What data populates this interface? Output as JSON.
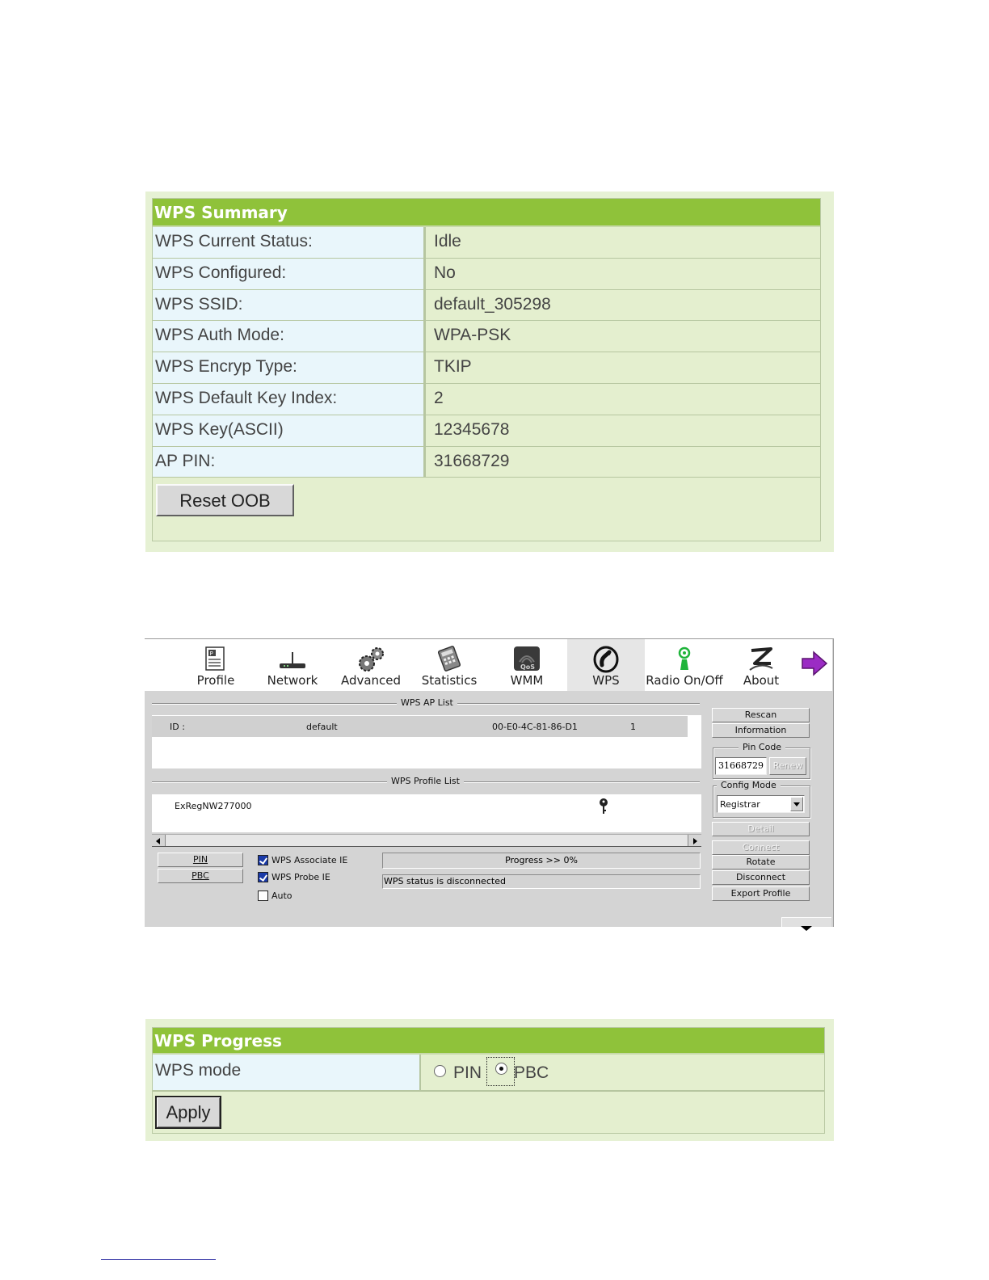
{
  "summary": {
    "title": "WPS Summary",
    "rows": [
      {
        "label": "WPS Current Status:",
        "value": "Idle"
      },
      {
        "label": "WPS Configured:",
        "value": "No"
      },
      {
        "label": "WPS SSID:",
        "value": "default_305298"
      },
      {
        "label": "WPS Auth Mode:",
        "value": "WPA-PSK"
      },
      {
        "label": "WPS Encryp Type:",
        "value": "TKIP"
      },
      {
        "label": "WPS Default Key Index:",
        "value": "2"
      },
      {
        "label": "WPS Key(ASCII)",
        "value": "12345678"
      },
      {
        "label": "AP PIN:",
        "value": "31668729"
      }
    ],
    "reset_button": "Reset OOB"
  },
  "utility": {
    "toolbar": [
      {
        "label": "Profile",
        "icon": "profile-icon"
      },
      {
        "label": "Network",
        "icon": "network-icon"
      },
      {
        "label": "Advanced",
        "icon": "gears-icon"
      },
      {
        "label": "Statistics",
        "icon": "calculator-icon"
      },
      {
        "label": "WMM",
        "icon": "qos-icon"
      },
      {
        "label": "WPS",
        "icon": "wps-icon"
      },
      {
        "label": "Radio On/Off",
        "icon": "radio-antenna-icon"
      },
      {
        "label": "About",
        "icon": "about-icon"
      }
    ],
    "ap_list_title": "WPS AP List",
    "ap_list": [
      {
        "id": "ID :",
        "ssid": "default",
        "mac": "00-E0-4C-81-86-D1",
        "channel": "1"
      }
    ],
    "profile_list_title": "WPS Profile List",
    "profile_list": [
      {
        "name": "ExRegNW277000"
      }
    ],
    "buttons": {
      "rescan": "Rescan",
      "information": "Information",
      "renew": "Renew",
      "detail": "Detail",
      "connect": "Connect",
      "rotate": "Rotate",
      "disconnect": "Disconnect",
      "export_profile": "Export Profile",
      "pin": "PIN",
      "pbc": "PBC"
    },
    "pin_code_label": "Pin Code",
    "pin_code_value": "31668729",
    "config_mode_label": "Config Mode",
    "config_mode_value": "Registrar",
    "checkboxes": [
      {
        "label": "WPS Associate IE",
        "checked": true
      },
      {
        "label": "WPS Probe IE",
        "checked": true
      },
      {
        "label": "Auto",
        "checked": false
      }
    ],
    "progress_text": "Progress >> 0%",
    "progress_fraction": 0,
    "status_text": "WPS status is disconnected"
  },
  "progress_panel": {
    "title": "WPS Progress",
    "mode_label": "WPS mode",
    "options": [
      "PIN",
      "PBC"
    ],
    "selected": "PBC",
    "apply_button": "Apply"
  },
  "colors": {
    "header_green": "#8fc23a",
    "panel_bg": "#e4efcf",
    "label_bg": "#e9f6fb",
    "window_gray": "#d4d4d4"
  }
}
